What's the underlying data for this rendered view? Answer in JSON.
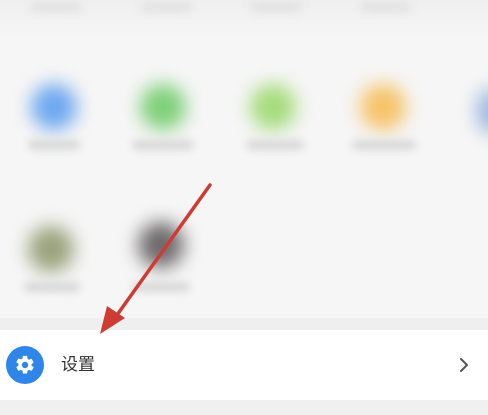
{
  "settings_row": {
    "label": "设置",
    "icon": "gear-icon",
    "chevron_icon": "chevron-right-icon"
  },
  "blurred_apps": [
    {
      "icon": "blurred-app-icon",
      "color": "#6ea8f0"
    },
    {
      "icon": "blurred-app-icon",
      "color": "#7fd07a"
    },
    {
      "icon": "blurred-app-icon",
      "color": "#a6dc7c"
    },
    {
      "icon": "blurred-app-icon",
      "color": "#f6c36a"
    },
    {
      "icon": "blurred-app-icon",
      "color": "#9aa37d"
    },
    {
      "icon": "blurred-app-icon",
      "color": "#6e6a6c"
    }
  ],
  "colors": {
    "accent": "#2f86e8",
    "arrow": "#cf3b33",
    "label": "#333333"
  }
}
